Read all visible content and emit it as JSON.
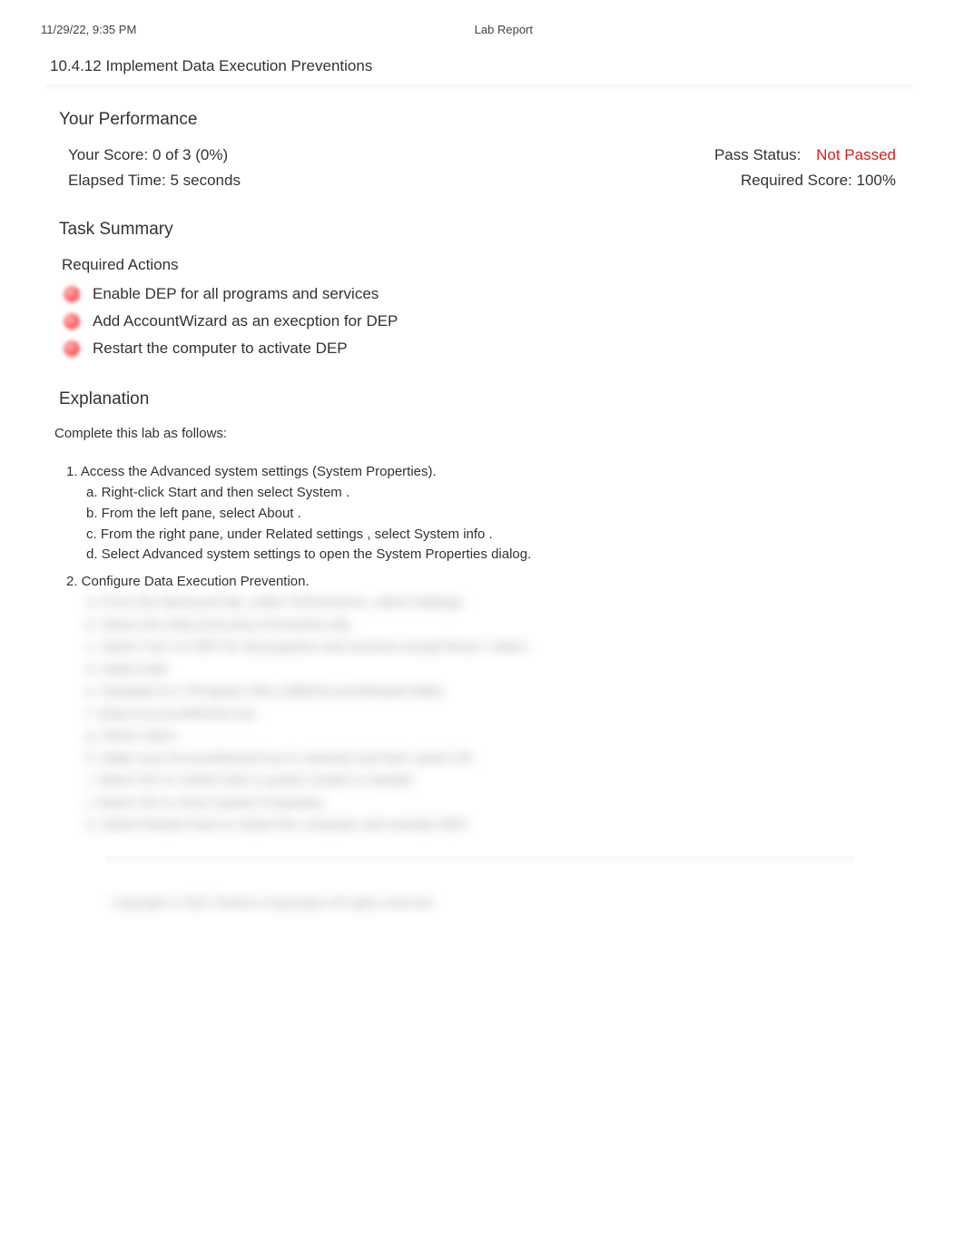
{
  "header": {
    "date": "11/29/22, 9:35 PM",
    "title": "Lab Report"
  },
  "lab": {
    "title": "10.4.12 Implement Data Execution Preventions"
  },
  "performance": {
    "heading": "Your Performance",
    "score_label": "Your Score:",
    "score_value": "0 of 3 (0%)",
    "pass_label": "Pass Status:",
    "pass_value": "Not Passed",
    "elapsed_label": "Elapsed Time:",
    "elapsed_value": "5 seconds",
    "required_label": "Required Score:",
    "required_value": "100%"
  },
  "task_summary": {
    "heading": "Task Summary",
    "required_heading": "Required Actions",
    "actions": [
      "Enable DEP for all programs and services",
      "Add AccountWizard as an execption for DEP",
      "Restart the computer to activate DEP"
    ]
  },
  "explanation": {
    "heading": "Explanation",
    "intro": "Complete this lab as follows:",
    "step1": {
      "title": "1. Access the Advanced system settings (System Properties).",
      "a": "a. Right-click   Start   and then select      System  .",
      "b": "b. From the left pane, select        About  .",
      "c": "c. From the right pane, under        Related settings  , select   System info    .",
      "d": "d. Select   Advanced system settings         to open the     System Properties    dialog."
    },
    "step2": {
      "title": "2. Configure Data Execution Prevention.",
      "a": "a. From the Advanced tab, under Performance, select            Settings  .",
      "b": "b. Select the      Data Execution Prevention          tab.",
      "c": "c. Select    Turn on DEP for all programs and services except those I select                 .",
      "d": "d. Select     Add  .",
      "e": "e. Navigate to     C:\\Program Files (x86)\\AccountWizard            folder.",
      "f": "f. Select    AccountWizard.exe  .",
      "g": "g. Select   Open  .",
      "h": "h. Make sure     AccountWizard.exe       is selected and then select         OK  .",
      "i": "i. Select   OK  to confirm that a system restart is needed.",
      "j": "j. Select   OK  to close System Properties.",
      "k": "k. Select   Restart Now       to restart the computer and activate DEP."
    }
  },
  "copyright": "Copyright © 2022 TestOut Corporation All rights reserved."
}
